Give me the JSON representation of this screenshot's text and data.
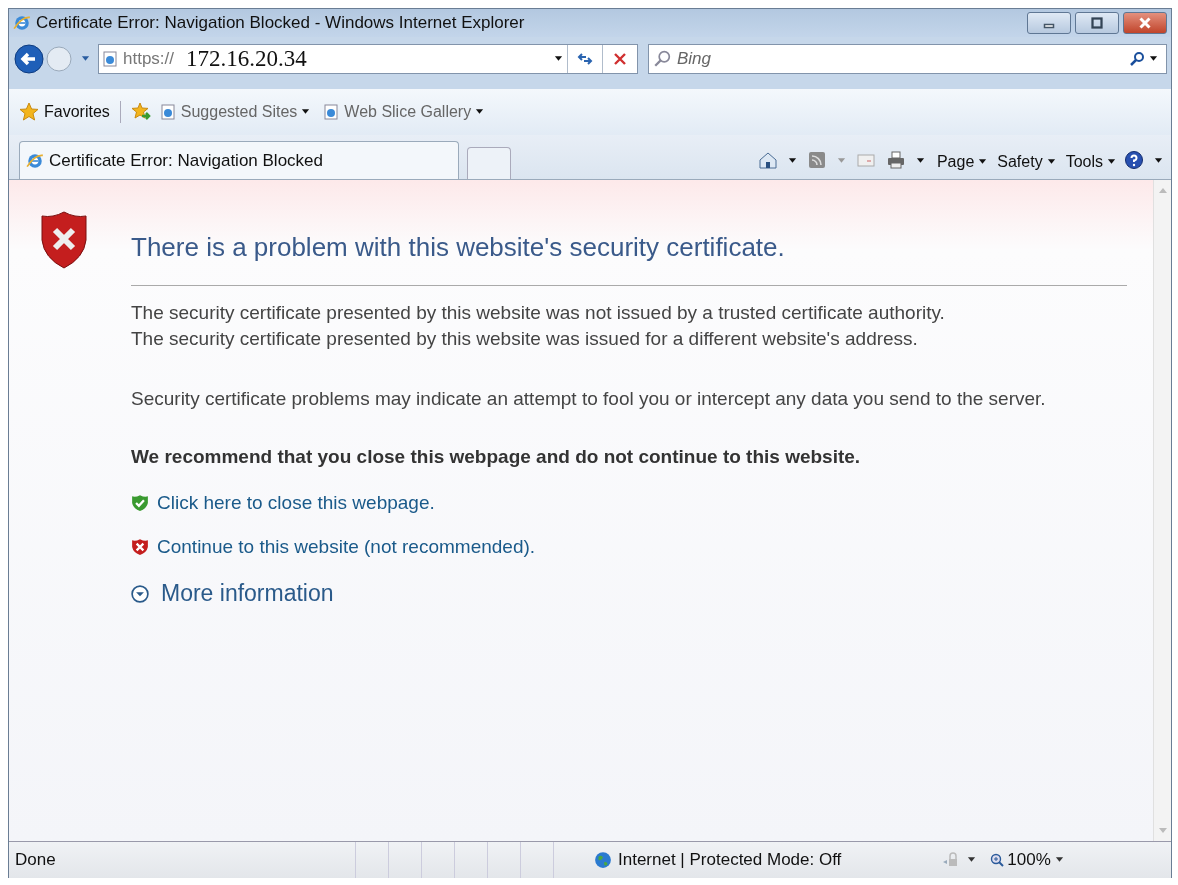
{
  "window": {
    "title": "Certificate Error: Navigation Blocked - Windows Internet Explorer"
  },
  "address": {
    "scheme": "https://",
    "host": "172.16.20.34"
  },
  "search": {
    "placeholder": "Bing"
  },
  "favorites": {
    "label": "Favorites",
    "links": [
      {
        "label": "Suggested Sites"
      },
      {
        "label": "Web Slice Gallery"
      }
    ]
  },
  "tabs": [
    {
      "label": "Certificate Error: Navigation Blocked",
      "selected": true
    }
  ],
  "commands": [
    {
      "label": "Page"
    },
    {
      "label": "Safety"
    },
    {
      "label": "Tools"
    }
  ],
  "content": {
    "heading": "There is a problem with this website's security certificate.",
    "paragraphs": [
      [
        "The security certificate presented by this website was not issued by a trusted certificate authority.",
        "The security certificate presented by this website was issued for a different website's address."
      ],
      [
        "Security certificate problems may indicate an attempt to fool you or intercept any data you send to the server."
      ]
    ],
    "recommendation": "We recommend that you close this webpage and do not continue to this website.",
    "links": [
      {
        "kind": "safe",
        "text": "Click here to close this webpage."
      },
      {
        "kind": "unsafe",
        "text": "Continue to this website (not recommended)."
      }
    ],
    "more": "More information"
  },
  "status": {
    "text": "Done",
    "zone": "Internet | Protected Mode: Off",
    "zoom": "100%"
  }
}
